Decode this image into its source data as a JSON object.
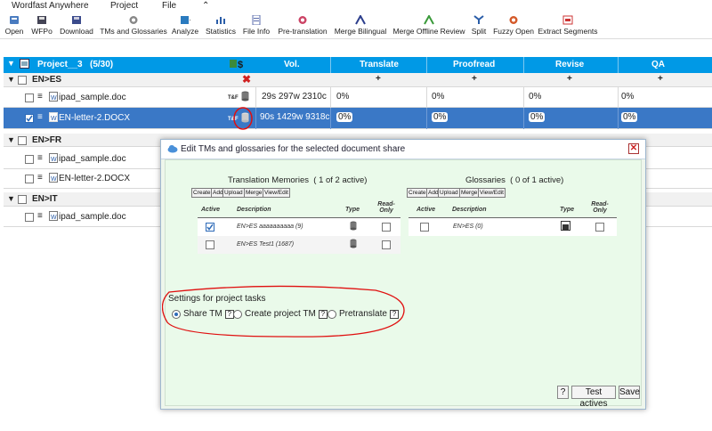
{
  "menu": {
    "app": "Wordfast Anywhere",
    "project": "Project",
    "file": "File",
    "collapse_icon": "chevron-up-icon"
  },
  "toolbar": [
    {
      "label": "Open",
      "icon": "open-icon"
    },
    {
      "label": "WFPo",
      "icon": "wfpo-icon"
    },
    {
      "label": "Download",
      "icon": "download-icon"
    },
    {
      "label": "TMs and Glossaries",
      "icon": "tm-gear-icon"
    },
    {
      "label": "Analyze",
      "icon": "analyze-icon"
    },
    {
      "label": "Statistics",
      "icon": "statistics-icon"
    },
    {
      "label": "File Info",
      "icon": "file-info-icon"
    },
    {
      "label": "Pre-translation",
      "icon": "pretranslation-icon"
    },
    {
      "label": "Merge Bilingual",
      "icon": "merge-bilingual-icon"
    },
    {
      "label": "Merge Offline Review",
      "icon": "merge-offline-icon"
    },
    {
      "label": "Split",
      "icon": "split-icon"
    },
    {
      "label": "Fuzzy Open",
      "icon": "fuzzy-open-icon"
    },
    {
      "label": "Extract Segments",
      "icon": "extract-icon"
    }
  ],
  "grid": {
    "header": {
      "project": "Project__3",
      "count": "(5/30)",
      "dollar": "$",
      "vol": "Vol.",
      "translate": "Translate",
      "proofread": "Proofread",
      "revise": "Revise",
      "qa": "QA"
    },
    "plus": "+",
    "close_mark": "✖",
    "groups": [
      {
        "label": "EN>ES",
        "files": [
          {
            "name": "ipad_sample.doc",
            "tag": "T&F",
            "vol": "29s  297w  2310c",
            "translate": "0%",
            "proofread": "0%",
            "revise": "0%",
            "qa": "0%",
            "selected": false
          },
          {
            "name": "EN-letter-2.DOCX",
            "tag": "T&F",
            "vol": "90s  1429w  9318c",
            "translate": "0%",
            "proofread": "0%",
            "revise": "0%",
            "qa": "0%",
            "selected": true
          }
        ]
      },
      {
        "label": "EN>FR",
        "files": [
          {
            "name": "ipad_sample.doc"
          },
          {
            "name": "EN-letter-2.DOCX"
          }
        ]
      },
      {
        "label": "EN>IT",
        "files": [
          {
            "name": "ipad_sample.doc"
          }
        ]
      }
    ]
  },
  "dialog": {
    "title": "Edit TMs and glossaries for the selected document share",
    "tm": {
      "title": "Translation Memories",
      "count": "( 1 of 2 active)",
      "buttons": [
        "Create",
        "Add",
        "Upload",
        "Merge",
        "View/Edit"
      ],
      "cols": [
        "Active",
        "Description",
        "Type",
        "Read-Only"
      ],
      "rows": [
        {
          "desc": "EN>ES aaaaaaaaaa (9)",
          "active": true,
          "readonly": false
        },
        {
          "desc": "EN>ES Test1 (1687)",
          "active": false,
          "readonly": false
        }
      ]
    },
    "gl": {
      "title": "Glossaries",
      "count": "( 0 of 1 active)",
      "buttons": [
        "Create",
        "Add",
        "Upload",
        "Merge",
        "View/Edit"
      ],
      "cols": [
        "Active",
        "Description",
        "Type",
        "Read-Only"
      ],
      "rows": [
        {
          "desc": "EN>ES (0)",
          "active": false,
          "readonly": false
        }
      ]
    },
    "settings": {
      "title": "Settings for project tasks",
      "options": [
        "Share TM",
        "Create project TM",
        "Pretranslate"
      ],
      "selected": "Share TM",
      "help": "?"
    },
    "footer": {
      "help": "?",
      "test": "Test actives",
      "save": "Save"
    }
  }
}
